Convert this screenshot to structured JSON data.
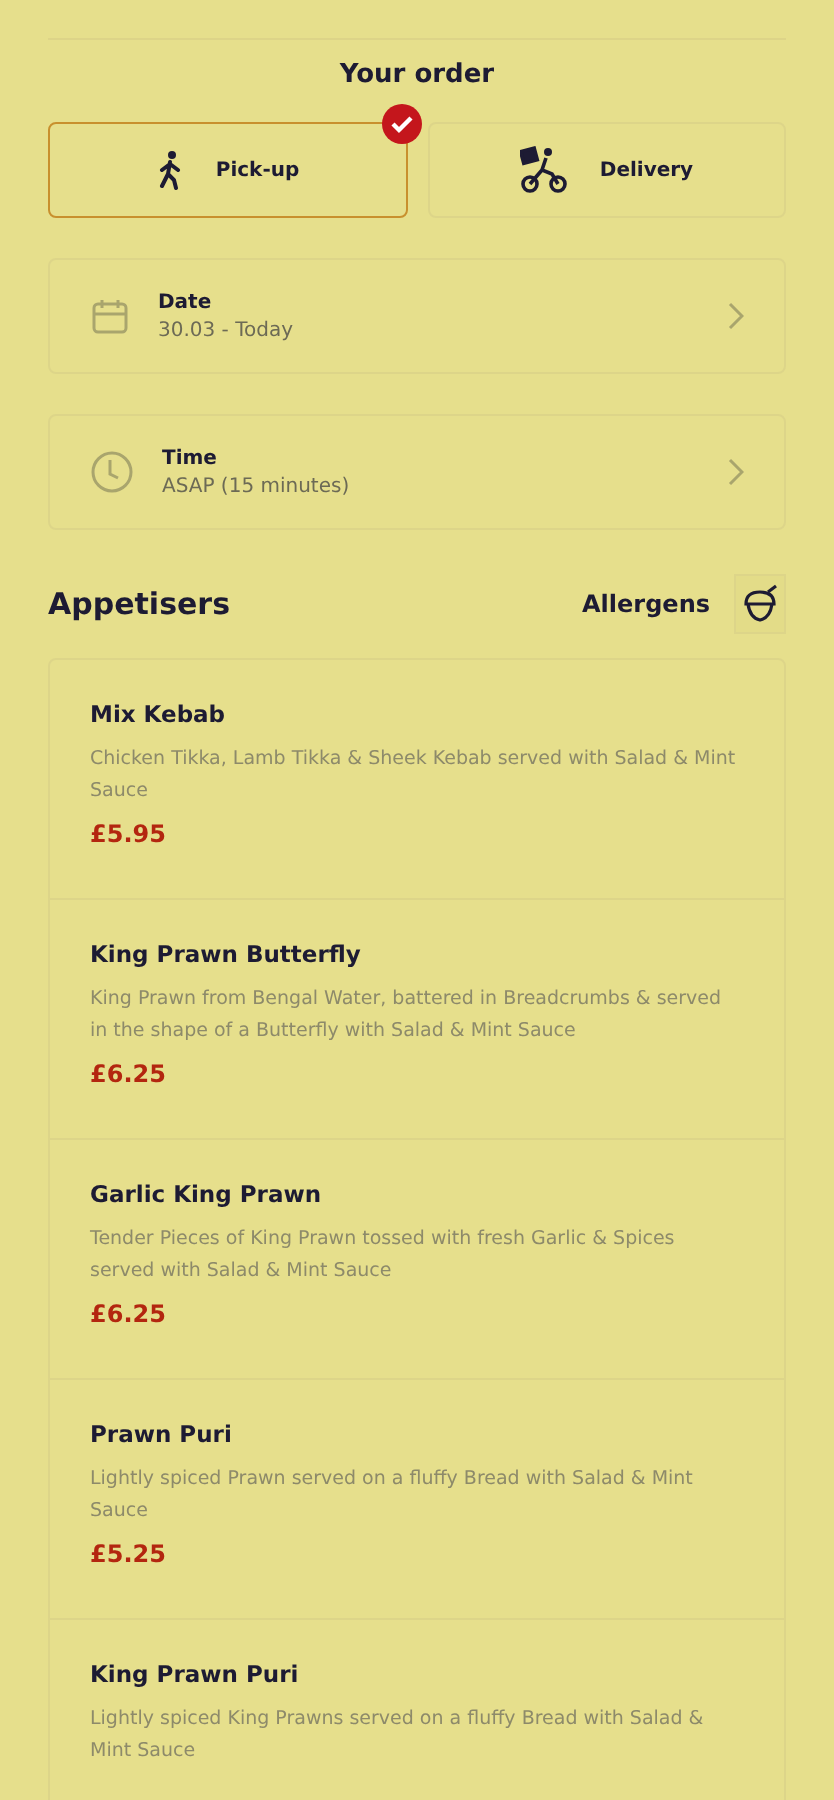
{
  "title": "Your order",
  "modes": [
    {
      "kind": "walk",
      "label": "Pick-up",
      "selected": true
    },
    {
      "kind": "bike",
      "label": "Delivery",
      "selected": false
    }
  ],
  "options": [
    {
      "kind": "calendar",
      "label": "Date",
      "value": "30.03 - Today"
    },
    {
      "kind": "clock",
      "label": "Time",
      "value": "ASAP (15 minutes)"
    }
  ],
  "section": {
    "title": "Appetisers",
    "allergens": "Allergens"
  },
  "items": [
    {
      "name": "Mix Kebab",
      "description": "Chicken Tikka, Lamb Tikka & Sheek Kebab served with Salad & Mint Sauce",
      "price": "£5.95"
    },
    {
      "name": "King Prawn Butterfly",
      "description": "King Prawn from Bengal Water, battered in Breadcrumbs & served in the shape of a Butterfly with Salad & Mint Sauce",
      "price": "£6.25"
    },
    {
      "name": "Garlic King Prawn",
      "description": "Tender Pieces of King Prawn tossed with fresh Garlic & Spices served with Salad & Mint Sauce",
      "price": "£6.25"
    },
    {
      "name": "Prawn Puri",
      "description": "Lightly spiced Prawn served on a fluffy Bread with Salad & Mint Sauce",
      "price": "£5.25"
    },
    {
      "name": "King Prawn Puri",
      "description": "Lightly spiced King Prawns served on a fluffy Bread with Salad & Mint Sauce"
    }
  ]
}
